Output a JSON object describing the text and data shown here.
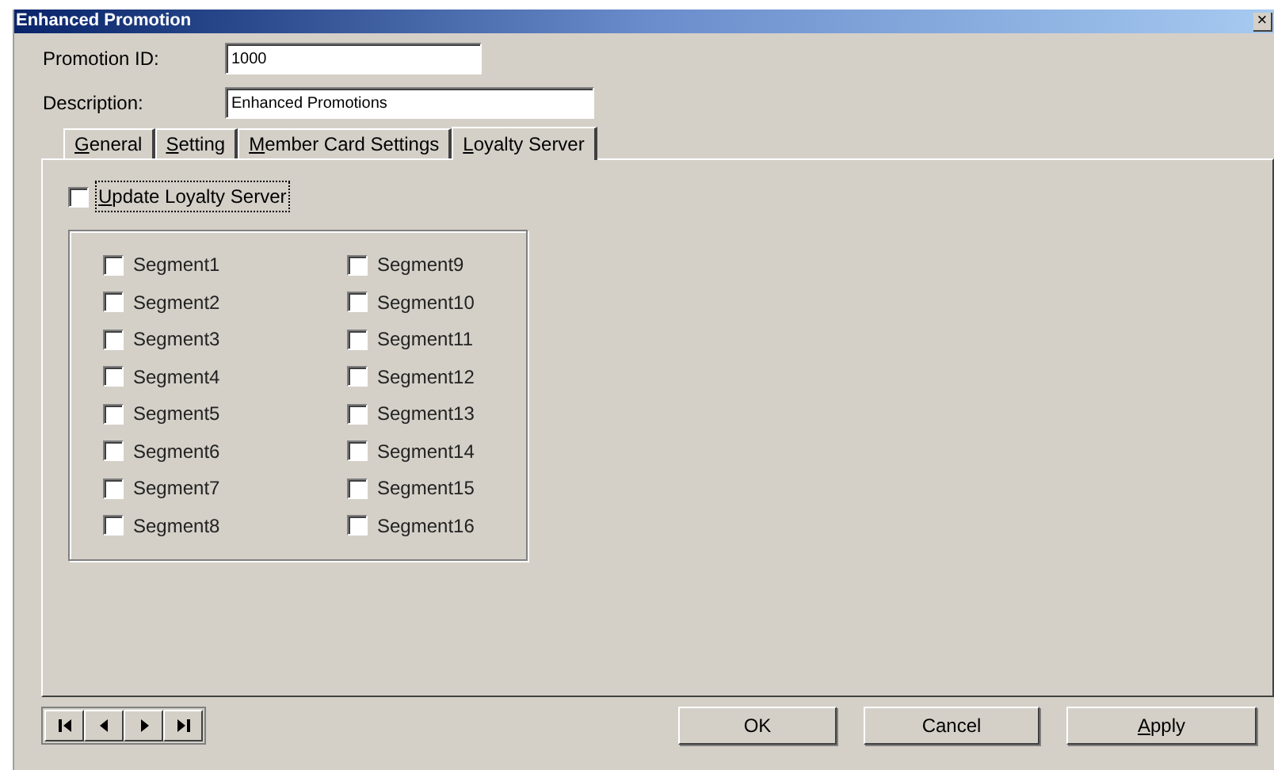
{
  "window": {
    "title": "Enhanced Promotion",
    "close": "×"
  },
  "fields": [
    {
      "label": "Promotion ID:",
      "value": "1000"
    },
    {
      "label": "Description:",
      "value": "Enhanced Promotions"
    }
  ],
  "tabs": [
    {
      "label": "General",
      "mnemonic": true,
      "selected": false
    },
    {
      "label": "Setting",
      "mnemonic": true,
      "selected": false
    },
    {
      "label": "Member Card Settings",
      "mnemonic": true,
      "selected": false
    },
    {
      "label": "Loyalty Server",
      "mnemonic": true,
      "selected": true
    }
  ],
  "update_checkbox": {
    "label": "Update Loyalty Server",
    "checked": false,
    "mnemonic": true,
    "focused": true
  },
  "segments": [
    {
      "label": "Segment1",
      "checked": false
    },
    {
      "label": "Segment2",
      "checked": false
    },
    {
      "label": "Segment3",
      "checked": false
    },
    {
      "label": "Segment4",
      "checked": false
    },
    {
      "label": "Segment5",
      "checked": false
    },
    {
      "label": "Segment6",
      "checked": false
    },
    {
      "label": "Segment7",
      "checked": false
    },
    {
      "label": "Segment8",
      "checked": false
    },
    {
      "label": "Segment9",
      "checked": false
    },
    {
      "label": "Segment10",
      "checked": false
    },
    {
      "label": "Segment11",
      "checked": false
    },
    {
      "label": "Segment12",
      "checked": false
    },
    {
      "label": "Segment13",
      "checked": false
    },
    {
      "label": "Segment14",
      "checked": false
    },
    {
      "label": "Segment15",
      "checked": false
    },
    {
      "label": "Segment16",
      "checked": false
    }
  ],
  "nav_buttons": [
    {
      "kind": "first"
    },
    {
      "kind": "previous"
    },
    {
      "kind": "next"
    },
    {
      "kind": "last"
    }
  ],
  "buttons": [
    {
      "label": "OK",
      "mnemonic": false
    },
    {
      "label": "Cancel",
      "mnemonic": false
    },
    {
      "label": "Apply",
      "mnemonic": true
    }
  ]
}
